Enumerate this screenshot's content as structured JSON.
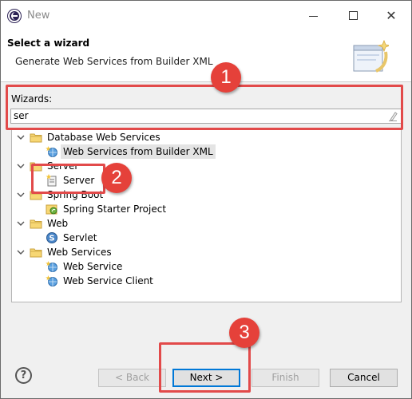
{
  "window": {
    "title": "New"
  },
  "header": {
    "title": "Select a wizard",
    "description": "Generate Web Services from Builder XML"
  },
  "wizards": {
    "label": "Wizards:",
    "filter_value": "ser"
  },
  "tree": [
    {
      "label": "Database Web Services",
      "type": "folder",
      "expanded": true
    },
    {
      "label": "Web Services from Builder XML",
      "type": "item",
      "selected": true,
      "icon": "web-services-wizard-icon"
    },
    {
      "label": "Server",
      "type": "folder",
      "expanded": true
    },
    {
      "label": "Server",
      "type": "item",
      "icon": "server-icon"
    },
    {
      "label": "Spring Boot",
      "type": "folder",
      "expanded": true
    },
    {
      "label": "Spring Starter Project",
      "type": "item",
      "icon": "spring-project-icon"
    },
    {
      "label": "Web",
      "type": "folder",
      "expanded": true
    },
    {
      "label": "Servlet",
      "type": "item",
      "icon": "servlet-icon"
    },
    {
      "label": "Web Services",
      "type": "folder",
      "expanded": true
    },
    {
      "label": "Web Service",
      "type": "item",
      "icon": "web-service-icon"
    },
    {
      "label": "Web Service Client",
      "type": "item",
      "icon": "web-service-client-icon"
    }
  ],
  "footer": {
    "help": "?",
    "back": "< Back",
    "next": "Next >",
    "finish": "Finish",
    "cancel": "Cancel"
  },
  "annotations": {
    "badge1": "1",
    "badge2": "2",
    "badge3": "3",
    "color": "#e24a4a"
  }
}
